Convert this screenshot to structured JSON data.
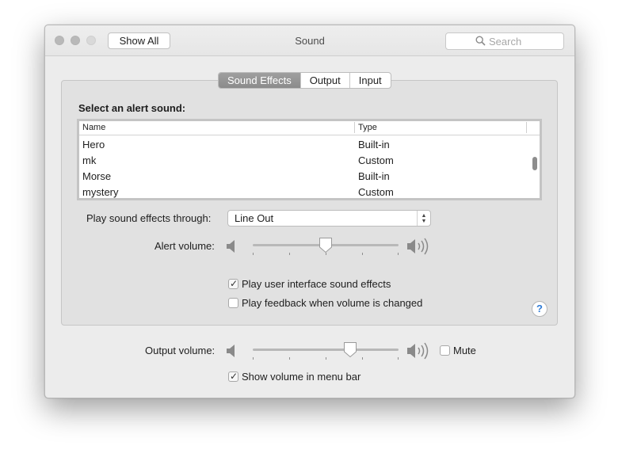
{
  "window": {
    "title": "Sound",
    "show_all_label": "Show All",
    "search_placeholder": "Search"
  },
  "tabs": [
    {
      "label": "Sound Effects",
      "selected": true
    },
    {
      "label": "Output",
      "selected": false
    },
    {
      "label": "Input",
      "selected": false
    }
  ],
  "alert": {
    "heading": "Select an alert sound:",
    "columns": {
      "name": "Name",
      "type": "Type"
    },
    "rows": [
      {
        "name": "Hero",
        "type": "Built-in"
      },
      {
        "name": "mk",
        "type": "Custom"
      },
      {
        "name": "Morse",
        "type": "Built-in"
      },
      {
        "name": "mystery",
        "type": "Custom"
      }
    ]
  },
  "effects": {
    "play_through_label": "Play sound effects through:",
    "play_through_value": "Line Out",
    "alert_volume_label": "Alert volume:",
    "alert_volume_level": 0.5,
    "ui_sounds_label": "Play user interface sound effects",
    "ui_sounds_checked": true,
    "feedback_label": "Play feedback when volume is changed",
    "feedback_checked": false,
    "help_label": "?"
  },
  "output": {
    "volume_label": "Output volume:",
    "volume_level": 0.67,
    "mute_label": "Mute",
    "mute_checked": false,
    "menu_bar_label": "Show volume in menu bar",
    "menu_bar_checked": true
  },
  "icons": {
    "search": "search-icon",
    "volume_low": "speaker-low-icon",
    "volume_high": "speaker-high-icon",
    "help": "help-icon"
  },
  "colors": {
    "tab_selected": "#939393",
    "help_accent": "#2f7bd6"
  }
}
